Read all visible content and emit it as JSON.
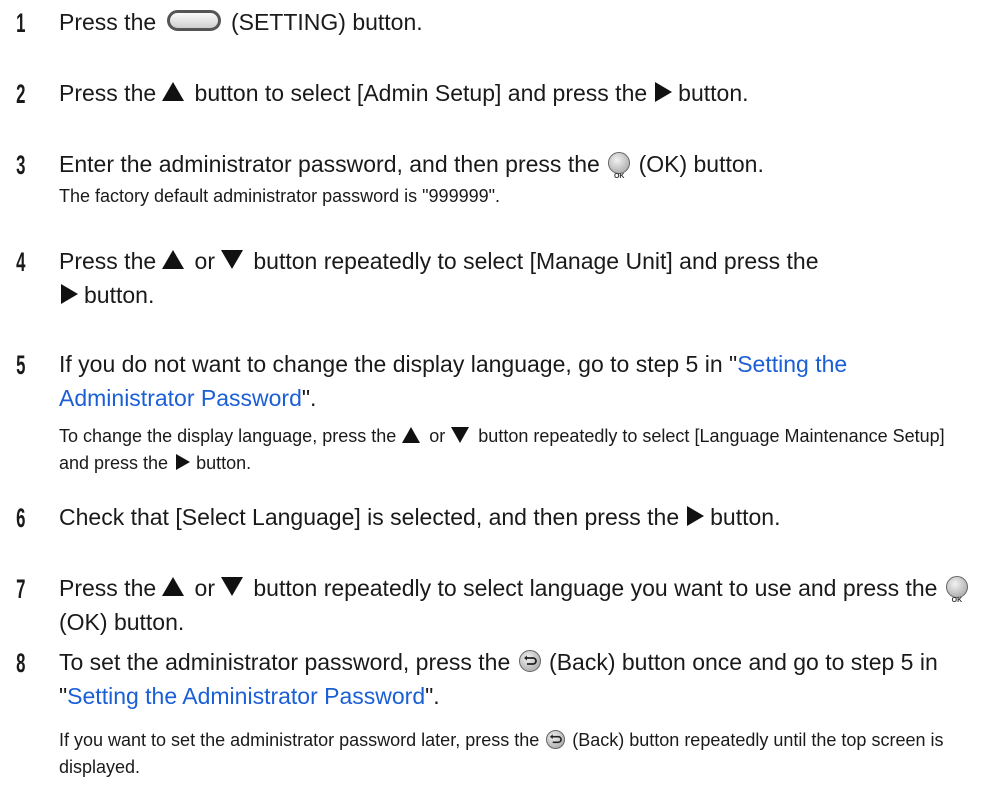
{
  "steps": [
    {
      "number": "1",
      "main": {
        "t1": "Press the",
        "t2": "(SETTING) button."
      }
    },
    {
      "number": "2",
      "main": {
        "t1": "Press the",
        "t2": "button to select [Admin Setup] and press the",
        "t3": "button."
      }
    },
    {
      "number": "3",
      "main": {
        "t1": "Enter the administrator password, and then press the",
        "t2": "(OK) button."
      },
      "note": {
        "t1": "The factory default administrator password is \"999999\"."
      }
    },
    {
      "number": "4",
      "main": {
        "t1": "Press the",
        "t2": "or",
        "t3": "button repeatedly to select [Manage Unit] and press the",
        "t4": "button."
      }
    },
    {
      "number": "5",
      "main": {
        "t1": "If you do not want to change the display language, go to step 5 in \"",
        "link": "Setting the Administrator Password",
        "t2": "\"."
      },
      "note": {
        "t1": "To change the display language, press the",
        "t2": "or",
        "t3": "button repeatedly to select [Language Maintenance Setup] and press the",
        "t4": "button."
      }
    },
    {
      "number": "6",
      "main": {
        "t1": "Check that [Select Language] is selected, and then press the",
        "t2": "button."
      }
    },
    {
      "number": "7",
      "main": {
        "t1": "Press the",
        "t2": "or",
        "t3": "button repeatedly to select language you want to use and press the",
        "t4": "(OK) button."
      }
    },
    {
      "number": "8",
      "main": {
        "t1": "To set the administrator password, press the",
        "t2": "(Back) button once and go to step 5 in \"",
        "link": "Setting the Administrator Password",
        "t3": "\"."
      },
      "note": {
        "t1": "If you want to set the administrator password later, press the",
        "t2": "(Back) button repeatedly until the top screen is displayed."
      }
    }
  ],
  "icons": {
    "setting": "setting-button-icon",
    "up": "up-arrow-icon",
    "down": "down-arrow-icon",
    "right": "right-arrow-icon",
    "ok": "ok-button-icon",
    "back": "back-button-icon",
    "ok_label": "OK"
  },
  "colors": {
    "link": "#1a5fd6",
    "text": "#1a1a1a"
  }
}
